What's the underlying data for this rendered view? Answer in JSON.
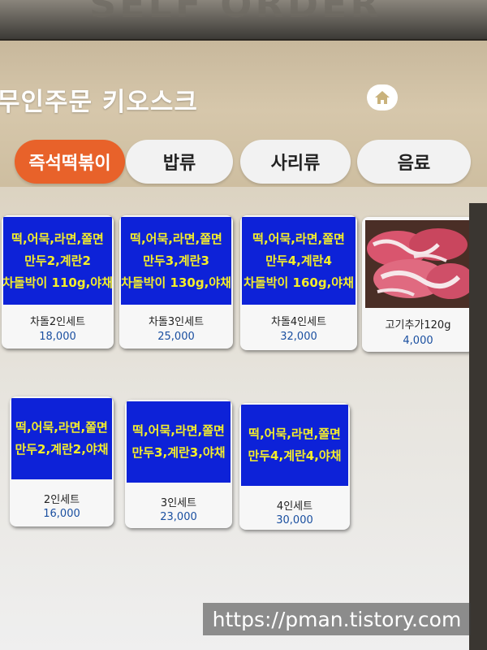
{
  "bezel_text": "SELF ORDER",
  "header": {
    "title": "무인주문 키오스크"
  },
  "tabs": [
    {
      "label": "즉석떡볶이",
      "active": true
    },
    {
      "label": "밥류",
      "active": false
    },
    {
      "label": "사리류",
      "active": false
    },
    {
      "label": "음료",
      "active": false
    }
  ],
  "products": [
    {
      "lines": [
        "떡,어묵,라면,쫄면",
        "만두2,계란2",
        "차돌박이 110g,야채"
      ],
      "name": "차돌2인세트",
      "price": "18,000"
    },
    {
      "lines": [
        "떡,어묵,라면,쫄면",
        "만두3,계란3",
        "차돌박이 130g,야채"
      ],
      "name": "차돌3인세트",
      "price": "25,000"
    },
    {
      "lines": [
        "떡,어묵,라면,쫄면",
        "만두4,계란4",
        "차돌박이 160g,야채"
      ],
      "name": "차돌4인세트",
      "price": "32,000"
    },
    {
      "image": "meat-photo",
      "name": "고기추가120g",
      "price": "4,000"
    },
    {
      "lines": [
        "떡,어묵,라면,쫄면",
        "만두2,계란2,야채"
      ],
      "name": "2인세트",
      "price": "16,000"
    },
    {
      "lines": [
        "떡,어묵,라면,쫄면",
        "만두3,계란3,야채"
      ],
      "name": "3인세트",
      "price": "23,000"
    },
    {
      "lines": [
        "떡,어묵,라면,쫄면",
        "만두4,계란4,야채"
      ],
      "name": "4인세트",
      "price": "30,000"
    }
  ],
  "watermark": "https://pman.tistory.com",
  "colors": {
    "active_tab": "#e8622a",
    "card_image_bg": "#0d22d8",
    "card_image_text": "#f4ee2a",
    "price_text": "#1a4fa0"
  },
  "icons": {
    "home": "home-icon"
  }
}
